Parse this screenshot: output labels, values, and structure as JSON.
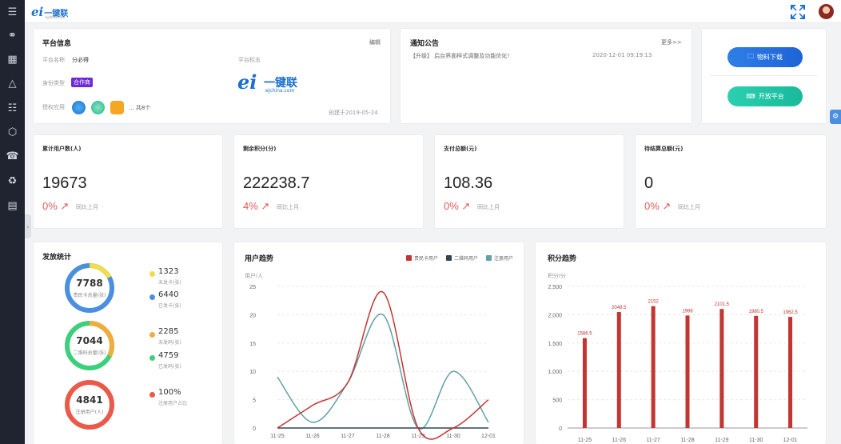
{
  "logo": {
    "text": "一键联",
    "sub": "ejchina.com"
  },
  "sidebar": {
    "icons": [
      "menu-icon",
      "share-icon",
      "building-icon",
      "triangle-icon",
      "list-icon",
      "hexagon-icon",
      "phone-icon",
      "recycle-icon",
      "document-icon"
    ]
  },
  "platform": {
    "title": "平台信息",
    "edit": "编辑",
    "name_label": "平台名称",
    "name_value": "分必得",
    "identity_label": "身份类型",
    "identity_value": "合作商",
    "apps_label": "授权应用",
    "apps_more": "... 共8个",
    "logo_label": "平台标志",
    "logo_big": "一键联",
    "logo_big_sub": "ejchina.com",
    "created": "创建于2019-05-24"
  },
  "notice": {
    "title": "通知公告",
    "more": "更多>>",
    "item_text": "【升级】 后台界面样式调整及功能优化！",
    "item_time": "2020-12-01 09:19:13"
  },
  "actions": {
    "download": "物料下载",
    "open": "开放平台"
  },
  "stats": [
    {
      "title": "累计用户数(人)",
      "value": "19673",
      "pct": "0%",
      "cmp": "同比上月"
    },
    {
      "title": "剩余积分(分)",
      "value": "222238.7",
      "pct": "4%",
      "cmp": "同比上月"
    },
    {
      "title": "支付总额(元)",
      "value": "108.36",
      "pct": "0%",
      "cmp": "同比上月"
    },
    {
      "title": "待结算总额(元)",
      "value": "0",
      "pct": "0%",
      "cmp": "同比上月"
    }
  ],
  "issue": {
    "title": "发放统计",
    "rings": [
      {
        "num": "7788",
        "label": "贵民卡总量(张)",
        "items": [
          {
            "value": "1323",
            "label": "未发卡(张)",
            "color": "#f1dc4c"
          },
          {
            "value": "6440",
            "label": "已发卡(张)",
            "color": "#4a8fe0"
          }
        ]
      },
      {
        "num": "7044",
        "label": "二维码总量(张)",
        "items": [
          {
            "value": "2285",
            "label": "未发码(张)",
            "color": "#f0ad3e"
          },
          {
            "value": "4759",
            "label": "已发码(张)",
            "color": "#3ecf7c"
          }
        ]
      },
      {
        "num": "4841",
        "label": "注册用户(人)",
        "items": [
          {
            "value": "100%",
            "label": "注册用户占比",
            "color": "#ea5a4a"
          }
        ]
      }
    ]
  },
  "colors": {
    "accent": "#4a8fe0",
    "bar": "#c23531",
    "red": "#e35a5a"
  },
  "chart_data": [
    {
      "type": "line",
      "title": "用户趋势",
      "ylabel": "用户/人",
      "x": [
        "11-25",
        "11-26",
        "11-27",
        "11-28",
        "11-29",
        "11-30",
        "12-01"
      ],
      "ylim": [
        0,
        25
      ],
      "yticks": [
        0,
        5,
        10,
        15,
        20,
        25
      ],
      "series": [
        {
          "name": "贵民卡用户",
          "color": "#c23531",
          "values": [
            0,
            4,
            8,
            24,
            0,
            0,
            5
          ]
        },
        {
          "name": "二维码用户",
          "color": "#2f4554",
          "values": [
            0,
            0,
            0,
            0,
            0,
            0,
            0
          ]
        },
        {
          "name": "注册用户",
          "color": "#61a0a8",
          "values": [
            9,
            1,
            8,
            20,
            0,
            10,
            1
          ]
        }
      ]
    },
    {
      "type": "bar",
      "title": "积分趋势",
      "ylabel": "积分/分",
      "categories": [
        "11-25",
        "11-26",
        "11-27",
        "11-28",
        "11-29",
        "11-30",
        "12-01"
      ],
      "values": [
        1586.5,
        2048.5,
        2152,
        1986,
        2101.5,
        1980.5,
        1962.5
      ],
      "labels": [
        "1586.5",
        "2048.5",
        "2152",
        "1986",
        "2101.5",
        "1980.5",
        "1962.5"
      ],
      "ylim": [
        0,
        2500
      ],
      "yticks": [
        0,
        500,
        1000,
        1500,
        2000,
        2500
      ],
      "yticklabels": [
        "0",
        "500",
        "1,000",
        "1,500",
        "2,000",
        "2,500"
      ]
    }
  ]
}
